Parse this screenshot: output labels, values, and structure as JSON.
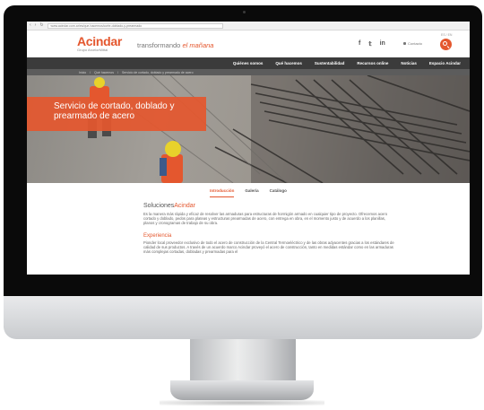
{
  "browser": {
    "url": "www.acindar.com.ar/es/que-hacemos/corte-doblado-y-prearmado"
  },
  "header": {
    "logo_name": "Acindar",
    "logo_sub": "Grupo ArcelorMittal",
    "tagline_lead": "transformando",
    "tagline_highlight": "el mañana",
    "contact_label": "Contacto",
    "lang_label": "ES / EN"
  },
  "nav": {
    "items": [
      "Quiénes somos",
      "Qué hacemos",
      "Sustentabilidad",
      "Recursos online",
      "Noticias",
      "Espacio Acindar"
    ]
  },
  "breadcrumb": [
    "Inicio",
    "Qué hacemos",
    "Servicio de cortado, doblado y prearmado de acero"
  ],
  "hero": {
    "title": "Servicio de cortado, doblado y prearmado de acero"
  },
  "tabs": [
    "Introducción",
    "Galería",
    "Catálogo"
  ],
  "content": {
    "section_title_lead": "Soluciones",
    "section_title_highlight": "Acindar",
    "intro_paragraph": "Es la manera más rápida y eficaz de resolver las armaduras para estructuras de hormigón armado en cualquier tipo de proyecto. Ofrecemos acero cortado y doblado, pedos para plateas y estructuras prearmadas de acero, con entrega en obra, en el momento justo y de acuerdo a los planillas, planos y cronogramas de trabajo de su obra.",
    "experience_title": "Experiencia",
    "experience_paragraph": "Pionder local proveedor exclusivo de todo el acero de construcción de la Central Termoeléctrico y de las obras adyacentes gracias a los estándares de calidad de sus productos. A través de un acuerdo marco Acindar proveyó el acero de construcción, tanto en medidas estándar como en las armaduras más complejas cortadas, dobladas y prearmadas para el"
  },
  "colors": {
    "brand_orange": "#e4572e",
    "nav_dark": "#3b3b3b"
  }
}
